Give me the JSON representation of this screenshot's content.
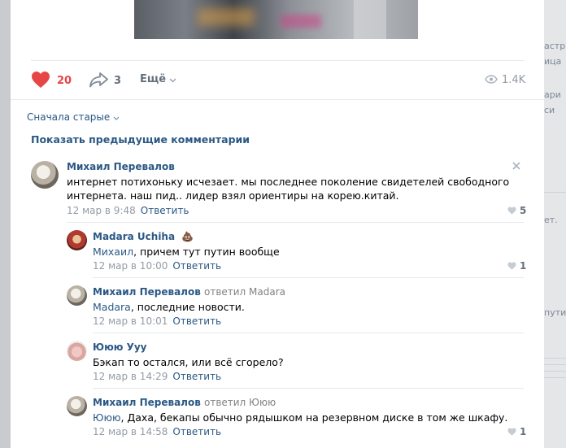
{
  "side_fragments": [
    "астр",
    "ица",
    "ари",
    "си",
    "ет.",
    "пути"
  ],
  "post": {
    "likes": "20",
    "shares": "3",
    "more": "Ещё",
    "views": "1.4K"
  },
  "comments_block": {
    "sort_label": "Сначала старые",
    "show_previous": "Показать предыдущие комментарии",
    "reply_label": "Ответить",
    "comments": [
      {
        "author": "Михаил Перевалов",
        "text_lines": [
          "интернет потихоньку исчезает. мы последнее поколение свидетелей свободного",
          "интернета. наш пид.. лидер взял ориентиры на корею.китай."
        ],
        "date": "12 мар в 9:48",
        "likes": "5"
      },
      {
        "author": "Madara Uchiha",
        "emoji": "💩",
        "mention": "Михаил",
        "text": ", причем тут путин вообще",
        "date": "12 мар в 10:00",
        "likes": "1"
      },
      {
        "author": "Михаил Перевалов",
        "replied_to": "ответил Madara",
        "mention": "Madara",
        "text": ", последние новости.",
        "date": "12 мар в 10:01"
      },
      {
        "author": "Ююю Ууу",
        "text": "Бэкап то остался, или всё сгорело?",
        "date": "12 мар в 14:29"
      },
      {
        "author": "Михаил Перевалов",
        "replied_to": "ответил Ююю",
        "mention": "Ююю",
        "text": ", Даха, бекапы обычно рядышком на резервном диске в том же шкафу.",
        "date": "12 мар в 14:58",
        "likes": "1"
      }
    ]
  },
  "colors": {
    "link": "#2a5885",
    "like_active": "#e64646",
    "muted": "#939ba6"
  },
  "icons": [
    "heart-icon",
    "share-icon",
    "chevron-down-icon",
    "eye-icon",
    "close-icon",
    "small-heart-icon"
  ]
}
